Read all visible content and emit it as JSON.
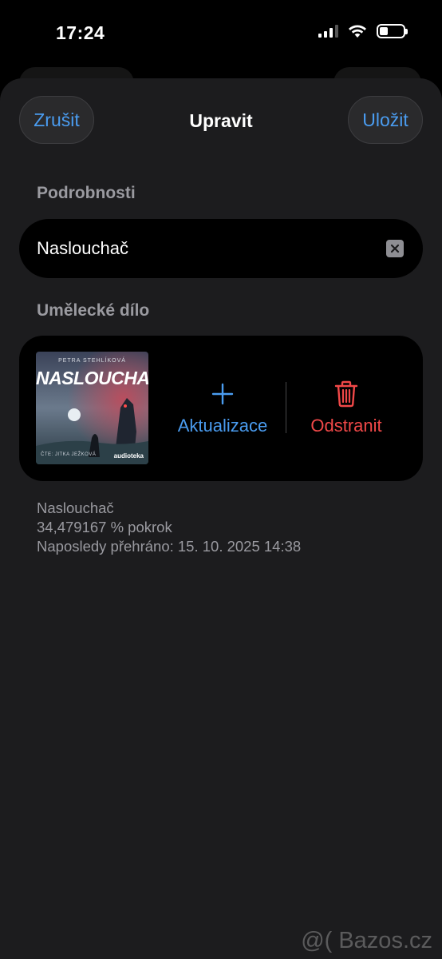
{
  "status_bar": {
    "time": "17:24",
    "signal_icon": "cellular-signal-icon",
    "wifi_icon": "wifi-icon",
    "battery_icon": "battery-icon"
  },
  "nav": {
    "cancel_label": "Zrušit",
    "title": "Upravit",
    "save_label": "Uložit"
  },
  "details": {
    "section_label": "Podrobnosti",
    "title_value": "Naslouchač",
    "clear_icon": "clear-icon"
  },
  "artwork": {
    "section_label": "Umělecké dílo",
    "cover": {
      "author": "PETRA STEHLÍKOVÁ",
      "title": "NASLOUCHAČ",
      "narrator": "ČTE: JITKA JEŽKOVÁ",
      "brand": "audioteka"
    },
    "update_label": "Aktualizace",
    "update_icon": "plus-icon",
    "remove_label": "Odstranit",
    "remove_icon": "trash-icon"
  },
  "info": {
    "title": "Naslouchač",
    "progress": "34,479167 % pokrok",
    "last_played": "Naposledy přehráno: 15. 10. 2025 14:38"
  },
  "watermark": "@( Bazos.cz",
  "colors": {
    "accent": "#4a9cf0",
    "destructive": "#f04848",
    "sheet": "#1c1c1e",
    "secondary_text": "#9a9aa0"
  }
}
